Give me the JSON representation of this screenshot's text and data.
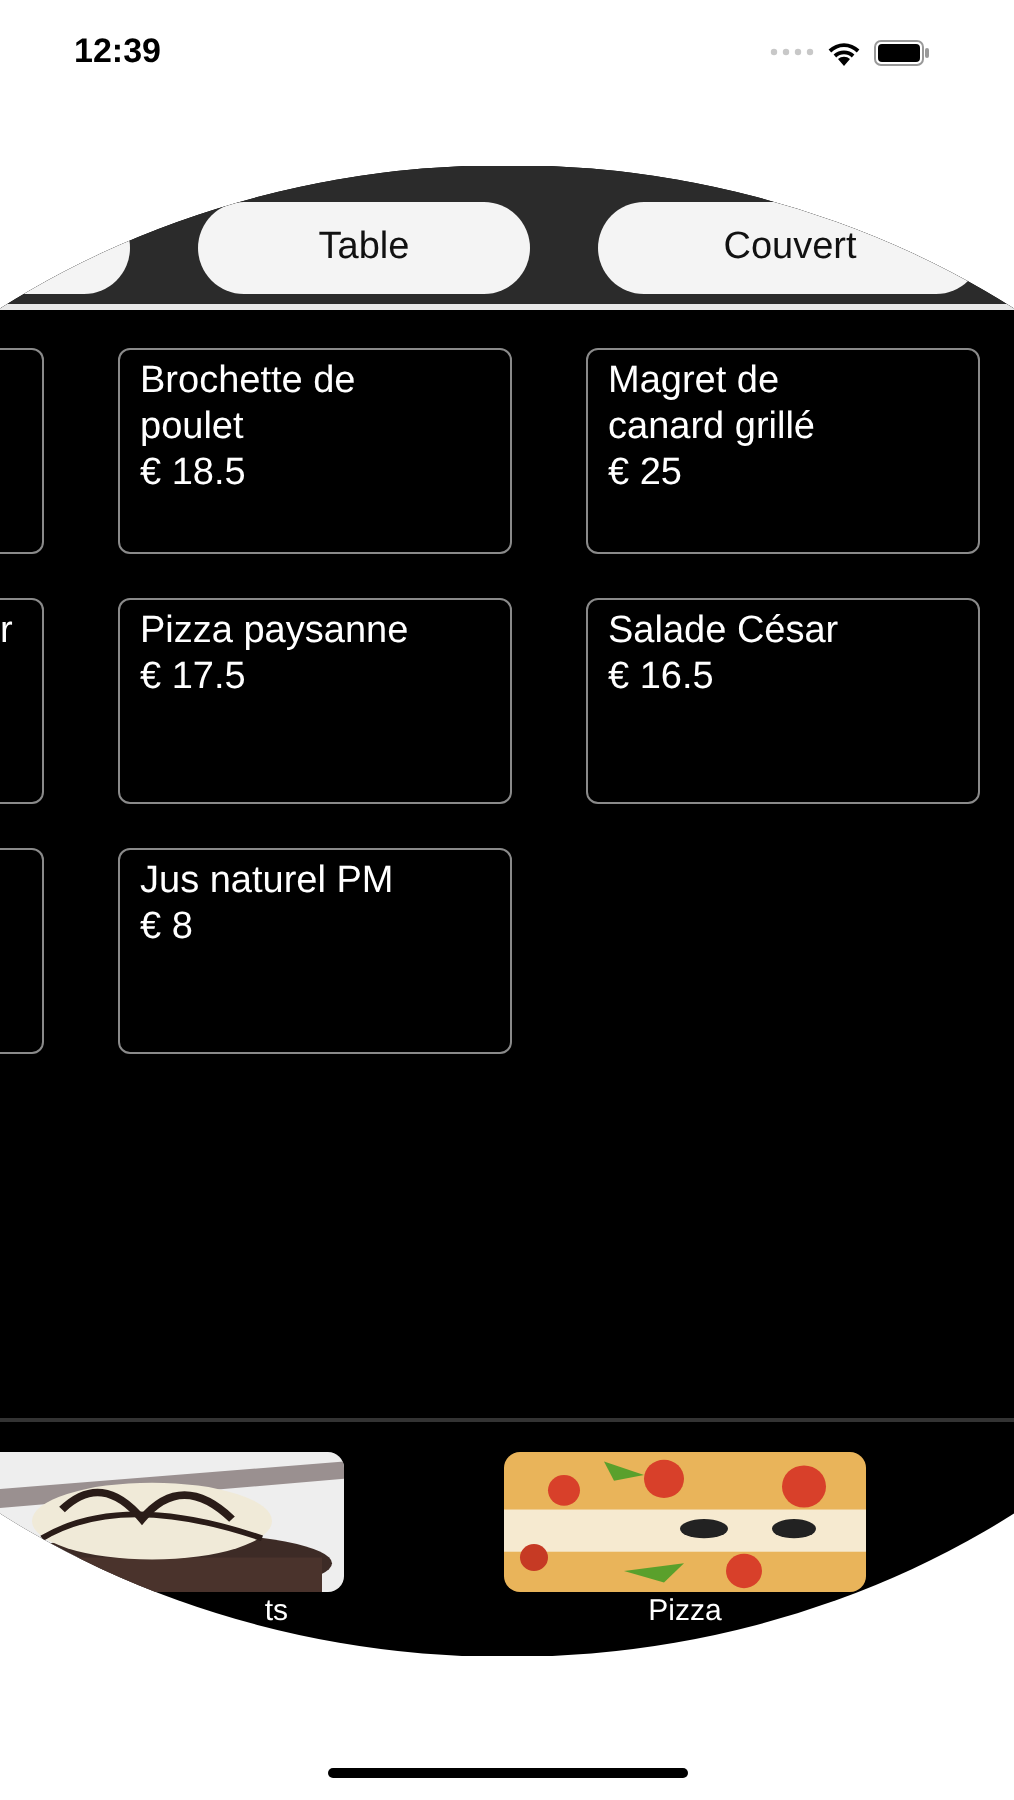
{
  "status_bar": {
    "time": "12:39"
  },
  "tabs": [
    {
      "kind": "partial"
    },
    {
      "kind": "full",
      "label": "Table"
    },
    {
      "kind": "full",
      "label": "Couvert"
    }
  ],
  "menu_items": [
    {
      "kind": "partial"
    },
    {
      "kind": "full",
      "name": "Brochette de poulet",
      "price": "€ 18.5"
    },
    {
      "kind": "full",
      "name": "Magret de canard grillé",
      "price": "€ 25"
    },
    {
      "kind": "partial",
      "name": "r"
    },
    {
      "kind": "full",
      "name": "Pizza paysanne",
      "price": "€ 17.5"
    },
    {
      "kind": "full",
      "name": "Salade César",
      "price": "€ 16.5"
    },
    {
      "kind": "partial"
    },
    {
      "kind": "full",
      "name": "Jus naturel PM",
      "price": "€ 8"
    }
  ],
  "categories": [
    {
      "kind": "partial",
      "label": "ts"
    },
    {
      "kind": "full",
      "label": "Pizza"
    }
  ]
}
